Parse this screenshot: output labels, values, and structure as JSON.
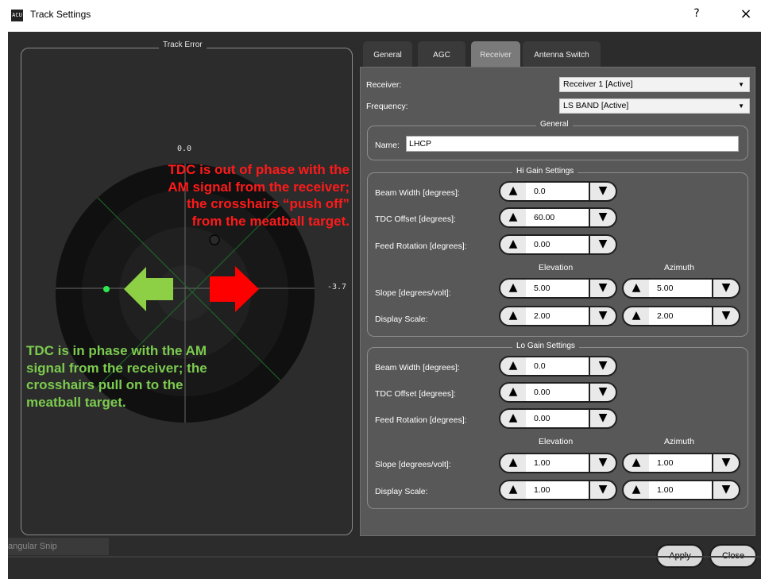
{
  "window": {
    "title": "Track Settings",
    "help_label": "?",
    "close_label": "×",
    "icon_label": "ACU"
  },
  "track_error": {
    "title": "Track Error",
    "top_scale": "0.0",
    "right_scale": "-3.7"
  },
  "annotations": {
    "red_lines": [
      "TDC is out of phase with the",
      "AM signal from the receiver;",
      "the crosshairs “push off”",
      "from the meatball target."
    ],
    "green_lines": [
      "TDC is in phase with the AM",
      "signal from the receiver; the",
      "crosshairs pull on to the",
      "meatball target."
    ],
    "red_color": "#ff1a1a",
    "green_color": "#7ccb4f"
  },
  "snip_label": "angular Snip",
  "tabs": [
    "General",
    "AGC",
    "Receiver",
    "Antenna Switch"
  ],
  "active_tab": "Receiver",
  "receiver": {
    "receiver_label": "Receiver:",
    "receiver_value": "Receiver 1 [Active]",
    "frequency_label": "Frequency:",
    "frequency_value": "LS BAND [Active]",
    "general_title": "General",
    "name_label": "Name:",
    "name_value": "LHCP"
  },
  "hi_gain": {
    "title": "Hi Gain Settings",
    "beam_width_label": "Beam Width [degrees]:",
    "beam_width": "0.0",
    "tdc_offset_label": "TDC Offset [degrees]:",
    "tdc_offset": "60.00",
    "feed_rotation_label": "Feed Rotation [degrees]:",
    "feed_rotation": "0.00",
    "elevation_label": "Elevation",
    "azimuth_label": "Azimuth",
    "slope_label": "Slope [degrees/volt]:",
    "slope_elevation": "5.00",
    "slope_azimuth": "5.00",
    "display_scale_label": "Display Scale:",
    "display_scale_elevation": "2.00",
    "display_scale_azimuth": "2.00"
  },
  "lo_gain": {
    "title": "Lo Gain Settings",
    "beam_width_label": "Beam Width [degrees]:",
    "beam_width": "0.0",
    "tdc_offset_label": "TDC Offset [degrees]:",
    "tdc_offset": "0.00",
    "feed_rotation_label": "Feed Rotation [degrees]:",
    "feed_rotation": "0.00",
    "elevation_label": "Elevation",
    "azimuth_label": "Azimuth",
    "slope_label": "Slope [degrees/volt]:",
    "slope_elevation": "1.00",
    "slope_azimuth": "1.00",
    "display_scale_label": "Display Scale:",
    "display_scale_elevation": "1.00",
    "display_scale_azimuth": "1.00"
  },
  "spin_glyphs": {
    "up": "▲",
    "down": "▼"
  },
  "dropdown_glyph": "▼",
  "buttons": {
    "apply": "Apply",
    "close": "Close"
  }
}
